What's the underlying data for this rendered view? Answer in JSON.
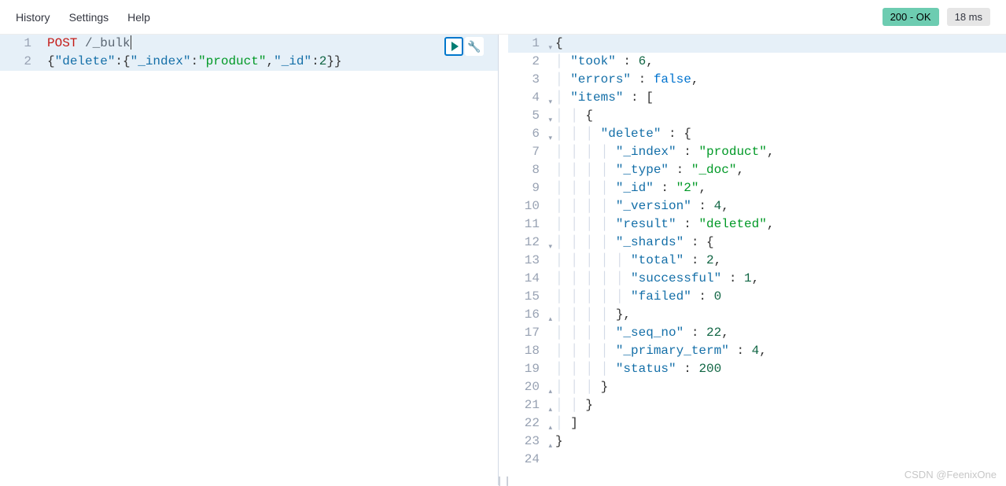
{
  "nav": {
    "history": "History",
    "settings": "Settings",
    "help": "Help"
  },
  "status": {
    "ok": "200 - OK",
    "time": "18 ms"
  },
  "request": {
    "line1": {
      "no": "1",
      "method": "POST",
      "path": " /_bulk"
    },
    "line2": {
      "no": "2",
      "k_delete": "\"delete\"",
      "k_index": "\"_index\"",
      "v_index": "\"product\"",
      "k_id": "\"_id\"",
      "v_id": "2"
    }
  },
  "response": {
    "l1": {
      "no": "1",
      "t": "{"
    },
    "l2": {
      "no": "2",
      "pad": "  ",
      "k": "\"took\"",
      "sep": " : ",
      "v": "6",
      "end": ","
    },
    "l3": {
      "no": "3",
      "pad": "  ",
      "k": "\"errors\"",
      "sep": " : ",
      "v": "false",
      "end": ","
    },
    "l4": {
      "no": "4",
      "pad": "  ",
      "k": "\"items\"",
      "sep": " : ",
      "v": "["
    },
    "l5": {
      "no": "5",
      "pad": "    ",
      "t": "{"
    },
    "l6": {
      "no": "6",
      "pad": "      ",
      "k": "\"delete\"",
      "sep": " : ",
      "v": "{"
    },
    "l7": {
      "no": "7",
      "pad": "        ",
      "k": "\"_index\"",
      "sep": " : ",
      "v": "\"product\"",
      "end": ","
    },
    "l8": {
      "no": "8",
      "pad": "        ",
      "k": "\"_type\"",
      "sep": " : ",
      "v": "\"_doc\"",
      "end": ","
    },
    "l9": {
      "no": "9",
      "pad": "        ",
      "k": "\"_id\"",
      "sep": " : ",
      "v": "\"2\"",
      "end": ","
    },
    "l10": {
      "no": "10",
      "pad": "        ",
      "k": "\"_version\"",
      "sep": " : ",
      "v": "4",
      "end": ","
    },
    "l11": {
      "no": "11",
      "pad": "        ",
      "k": "\"result\"",
      "sep": " : ",
      "v": "\"deleted\"",
      "end": ","
    },
    "l12": {
      "no": "12",
      "pad": "        ",
      "k": "\"_shards\"",
      "sep": " : ",
      "v": "{"
    },
    "l13": {
      "no": "13",
      "pad": "          ",
      "k": "\"total\"",
      "sep": " : ",
      "v": "2",
      "end": ","
    },
    "l14": {
      "no": "14",
      "pad": "          ",
      "k": "\"successful\"",
      "sep": " : ",
      "v": "1",
      "end": ","
    },
    "l15": {
      "no": "15",
      "pad": "          ",
      "k": "\"failed\"",
      "sep": " : ",
      "v": "0"
    },
    "l16": {
      "no": "16",
      "pad": "        ",
      "t": "},"
    },
    "l17": {
      "no": "17",
      "pad": "        ",
      "k": "\"_seq_no\"",
      "sep": " : ",
      "v": "22",
      "end": ","
    },
    "l18": {
      "no": "18",
      "pad": "        ",
      "k": "\"_primary_term\"",
      "sep": " : ",
      "v": "4",
      "end": ","
    },
    "l19": {
      "no": "19",
      "pad": "        ",
      "k": "\"status\"",
      "sep": " : ",
      "v": "200"
    },
    "l20": {
      "no": "20",
      "pad": "      ",
      "t": "}"
    },
    "l21": {
      "no": "21",
      "pad": "    ",
      "t": "}"
    },
    "l22": {
      "no": "22",
      "pad": "  ",
      "t": "]"
    },
    "l23": {
      "no": "23",
      "t": "}"
    },
    "l24": {
      "no": "24",
      "t": ""
    }
  },
  "watermark": "CSDN @FeenixOne"
}
